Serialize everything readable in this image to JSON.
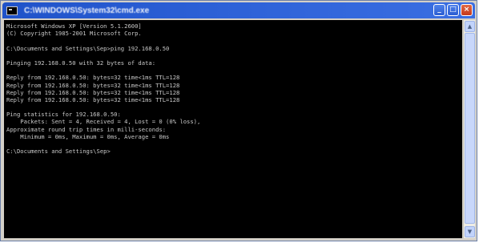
{
  "window": {
    "title": "C:\\WINDOWS\\System32\\cmd.exe",
    "icon": "cmd-icon",
    "controls": {
      "minimize": "_",
      "maximize": "□",
      "close": "×"
    }
  },
  "console": {
    "lines": [
      "Microsoft Windows XP [Version 5.1.2600]",
      "(C) Copyright 1985-2001 Microsoft Corp.",
      "",
      "C:\\Documents and Settings\\Sep>ping 192.168.0.50",
      "",
      "Pinging 192.168.0.50 with 32 bytes of data:",
      "",
      "Reply from 192.168.0.50: bytes=32 time<1ms TTL=128",
      "Reply from 192.168.0.50: bytes=32 time<1ms TTL=128",
      "Reply from 192.168.0.50: bytes=32 time<1ms TTL=128",
      "Reply from 192.168.0.50: bytes=32 time<1ms TTL=128",
      "",
      "Ping statistics for 192.168.0.50:",
      "    Packets: Sent = 4, Received = 4, Lost = 0 (0% loss),",
      "Approximate round trip times in milli-seconds:",
      "    Minimum = 0ms, Maximum = 0ms, Average = 0ms",
      "",
      "C:\\Documents and Settings\\Sep>"
    ]
  },
  "scrollbar": {
    "up_arrow": "▲",
    "down_arrow": "▼"
  }
}
